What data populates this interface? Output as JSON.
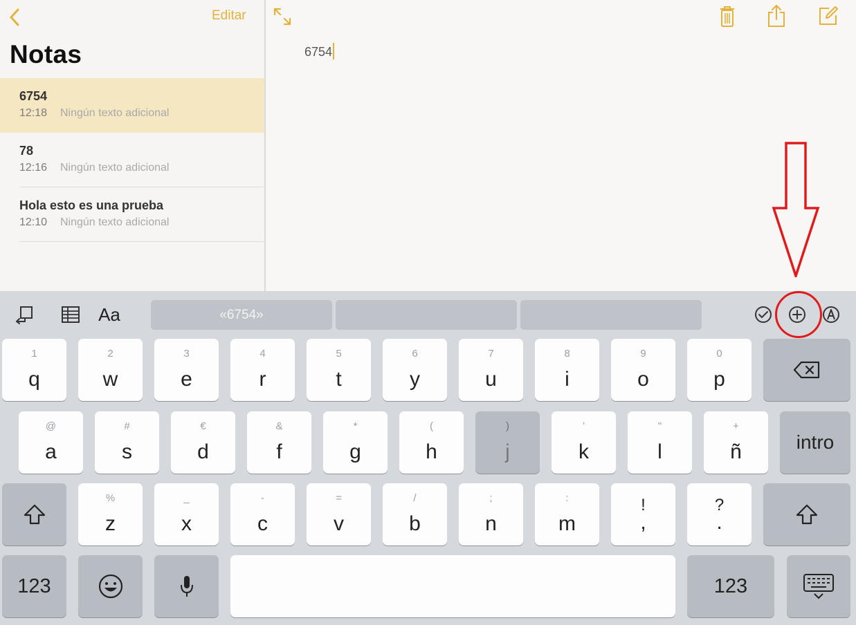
{
  "sidebar": {
    "title": "Notas",
    "edit_label": "Editar",
    "notes": [
      {
        "title": "6754",
        "time": "12:18",
        "subtitle": "Ningún texto adicional",
        "selected": true
      },
      {
        "title": "78",
        "time": "12:16",
        "subtitle": "Ningún texto adicional",
        "selected": false
      },
      {
        "title": "Hola esto es una prueba",
        "time": "12:10",
        "subtitle": "Ningún texto adicional",
        "selected": false
      }
    ]
  },
  "editor": {
    "text": "6754",
    "toolbar_icons": [
      "expand-icon",
      "trash-icon",
      "share-icon",
      "compose-icon"
    ]
  },
  "keyboard": {
    "toolbar": {
      "format_label": "Aa",
      "suggestions": [
        "«6754»",
        "",
        ""
      ],
      "icons": [
        "undo-redo-icon",
        "table-icon",
        "checklist-icon",
        "insert-plus-icon",
        "markup-icon"
      ]
    },
    "row1": [
      {
        "sec": "1",
        "pri": "q"
      },
      {
        "sec": "2",
        "pri": "w"
      },
      {
        "sec": "3",
        "pri": "e"
      },
      {
        "sec": "4",
        "pri": "r"
      },
      {
        "sec": "5",
        "pri": "t"
      },
      {
        "sec": "6",
        "pri": "y"
      },
      {
        "sec": "7",
        "pri": "u"
      },
      {
        "sec": "8",
        "pri": "i"
      },
      {
        "sec": "9",
        "pri": "o"
      },
      {
        "sec": "0",
        "pri": "p"
      }
    ],
    "row2": [
      {
        "sec": "@",
        "pri": "a"
      },
      {
        "sec": "#",
        "pri": "s"
      },
      {
        "sec": "€",
        "pri": "d"
      },
      {
        "sec": "&",
        "pri": "f"
      },
      {
        "sec": "*",
        "pri": "g"
      },
      {
        "sec": "(",
        "pri": "h"
      },
      {
        "sec": ")",
        "pri": "j"
      },
      {
        "sec": "’",
        "pri": "k"
      },
      {
        "sec": "\"",
        "pri": "l"
      },
      {
        "sec": "+",
        "pri": "ñ"
      }
    ],
    "row3": [
      {
        "sec": "%",
        "pri": "z"
      },
      {
        "sec": "_",
        "pri": "x"
      },
      {
        "sec": "-",
        "pri": "c"
      },
      {
        "sec": "=",
        "pri": "v"
      },
      {
        "sec": "/",
        "pri": "b"
      },
      {
        "sec": ";",
        "pri": "n"
      },
      {
        "sec": ":",
        "pri": "m"
      },
      {
        "sec": "!",
        "pri": ","
      },
      {
        "sec": "?",
        "pri": "."
      }
    ],
    "return_label": "intro",
    "numbers_label": "123",
    "pressed_key": "j"
  },
  "colors": {
    "accent": "#e3b23c",
    "selected_row": "#f5e7c2",
    "annotation": "#e01b1b"
  }
}
